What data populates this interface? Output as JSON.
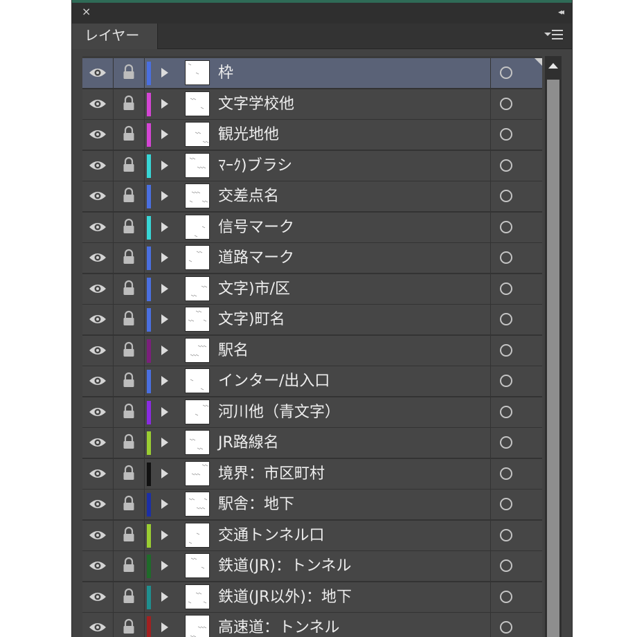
{
  "window": {
    "close_glyph": "×",
    "collapse_glyph": "◂◂"
  },
  "tab": {
    "label": "レイヤー"
  },
  "icons": {
    "visibility": "eye-icon",
    "lock": "lock-icon",
    "expand": "disclosure-triangle-icon",
    "target": "target-circle-icon",
    "panel_menu": "panel-menu-icon"
  },
  "layers": [
    {
      "name": "枠",
      "color": "#4a6fe0",
      "selected": true
    },
    {
      "name": "文字学校他",
      "color": "#d445d4",
      "selected": false
    },
    {
      "name": "観光地他",
      "color": "#d445d4",
      "selected": false
    },
    {
      "name": "ﾏｰｸ)ブラシ",
      "color": "#38d6d6",
      "selected": false
    },
    {
      "name": "交差点名",
      "color": "#4a6fe0",
      "selected": false
    },
    {
      "name": "信号マーク",
      "color": "#38d6d6",
      "selected": false
    },
    {
      "name": "道路マーク",
      "color": "#4a6fe0",
      "selected": false
    },
    {
      "name": "文字)市/区",
      "color": "#4a6fe0",
      "selected": false
    },
    {
      "name": "文字)町名",
      "color": "#4a6fe0",
      "selected": false
    },
    {
      "name": "駅名",
      "color": "#7b1f7b",
      "selected": false
    },
    {
      "name": "インター/出入口",
      "color": "#4a6fe0",
      "selected": false
    },
    {
      "name": "河川他（青文字）",
      "color": "#8a2be2",
      "selected": false
    },
    {
      "name": "JR路線名",
      "color": "#9acd32",
      "selected": false
    },
    {
      "name": "境界：市区町村",
      "color": "#111111",
      "selected": false
    },
    {
      "name": "駅舎：地下",
      "color": "#1c2fa6",
      "selected": false
    },
    {
      "name": "交通トンネル口",
      "color": "#9acd32",
      "selected": false
    },
    {
      "name": "鉄道(JR)：トンネル",
      "color": "#1f6b2a",
      "selected": false
    },
    {
      "name": "鉄道(JR以外)：地下",
      "color": "#1f8f8f",
      "selected": false
    },
    {
      "name": "高速道：トンネル",
      "color": "#a12020",
      "selected": false
    }
  ]
}
